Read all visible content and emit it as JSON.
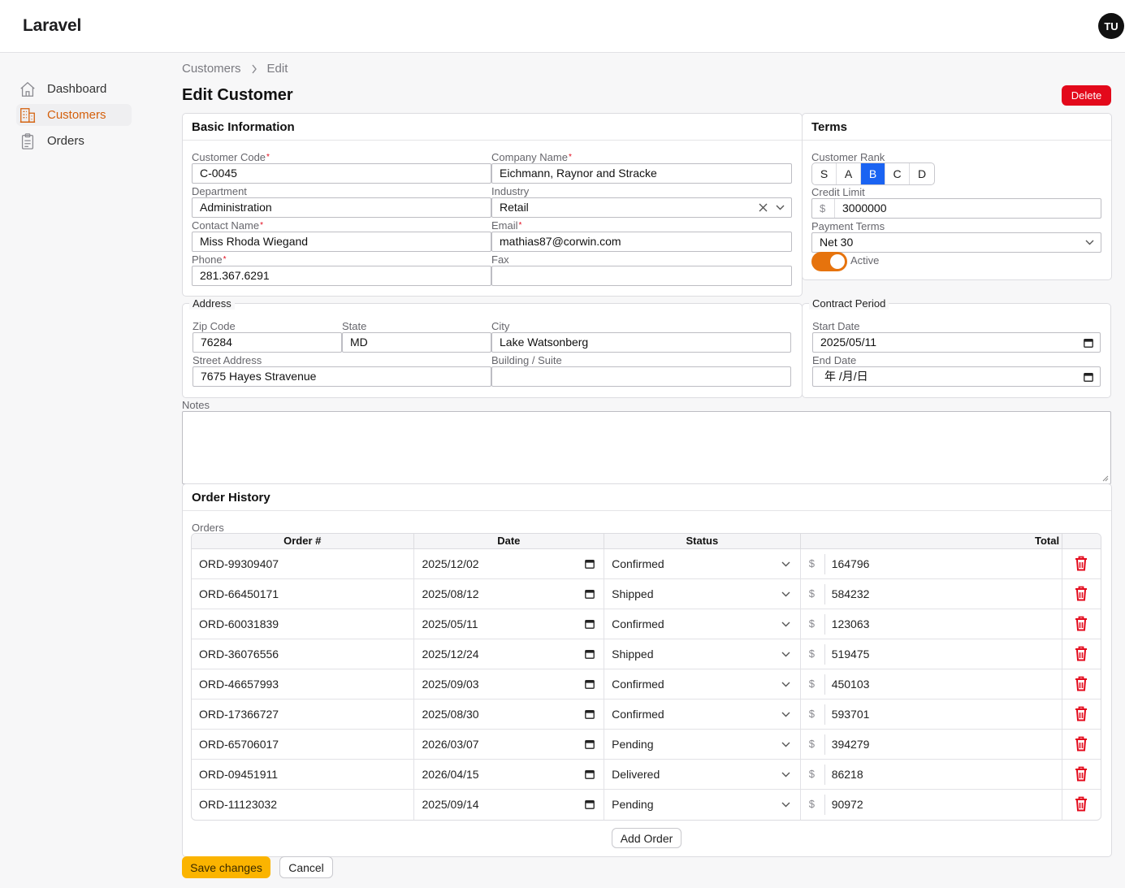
{
  "app": {
    "brand": "Laravel",
    "user_initials": "TU"
  },
  "sidebar": {
    "items": [
      {
        "label": "Dashboard",
        "icon": "home-icon"
      },
      {
        "label": "Customers",
        "icon": "building-icon",
        "active": true
      },
      {
        "label": "Orders",
        "icon": "clipboard-icon"
      }
    ]
  },
  "breadcrumb": {
    "parent": "Customers",
    "current": "Edit"
  },
  "page": {
    "title": "Edit Customer",
    "delete_label": "Delete"
  },
  "basic": {
    "heading": "Basic Information",
    "customer_code_label": "Customer Code",
    "customer_code": "C-0045",
    "company_name_label": "Company Name",
    "company_name": "Eichmann, Raynor and Stracke",
    "department_label": "Department",
    "department": "Administration",
    "industry_label": "Industry",
    "industry": "Retail",
    "contact_name_label": "Contact Name",
    "contact_name": "Miss Rhoda Wiegand",
    "email_label": "Email",
    "email": "mathias87@corwin.com",
    "phone_label": "Phone",
    "phone": "281.367.6291",
    "fax_label": "Fax",
    "fax": ""
  },
  "terms": {
    "heading": "Terms",
    "rank_label": "Customer Rank",
    "ranks": [
      "S",
      "A",
      "B",
      "C",
      "D"
    ],
    "selected_rank": "B",
    "credit_limit_label": "Credit Limit",
    "currency": "$",
    "credit_limit": "3000000",
    "payment_terms_label": "Payment Terms",
    "payment_terms": "Net 30",
    "active_label": "Active",
    "active": true
  },
  "address": {
    "legend": "Address",
    "zip_label": "Zip Code",
    "zip": "76284",
    "state_label": "State",
    "state": "MD",
    "city_label": "City",
    "city": "Lake Watsonberg",
    "street_label": "Street Address",
    "street": "7675 Hayes Stravenue",
    "building_label": "Building / Suite",
    "building": ""
  },
  "contract": {
    "legend": "Contract Period",
    "start_label": "Start Date",
    "start": "2025/05/11",
    "end_label": "End Date",
    "end_placeholder": "年 /月/日"
  },
  "notes": {
    "label": "Notes",
    "value": ""
  },
  "order_history": {
    "heading": "Order History",
    "orders_label": "Orders",
    "columns": [
      "Order #",
      "Date",
      "Status",
      "Total"
    ],
    "rows": [
      {
        "order_no": "ORD-99309407",
        "date": "2025/12/02",
        "status": "Confirmed",
        "total": "164796"
      },
      {
        "order_no": "ORD-66450171",
        "date": "2025/08/12",
        "status": "Shipped",
        "total": "584232"
      },
      {
        "order_no": "ORD-60031839",
        "date": "2025/05/11",
        "status": "Confirmed",
        "total": "123063"
      },
      {
        "order_no": "ORD-36076556",
        "date": "2025/12/24",
        "status": "Shipped",
        "total": "519475"
      },
      {
        "order_no": "ORD-46657993",
        "date": "2025/09/03",
        "status": "Confirmed",
        "total": "450103"
      },
      {
        "order_no": "ORD-17366727",
        "date": "2025/08/30",
        "status": "Confirmed",
        "total": "593701"
      },
      {
        "order_no": "ORD-65706017",
        "date": "2026/03/07",
        "status": "Pending",
        "total": "394279"
      },
      {
        "order_no": "ORD-09451911",
        "date": "2026/04/15",
        "status": "Delivered",
        "total": "86218"
      },
      {
        "order_no": "ORD-11123032",
        "date": "2025/09/14",
        "status": "Pending",
        "total": "90972"
      }
    ],
    "add_label": "Add Order"
  },
  "actions": {
    "save_label": "Save changes",
    "cancel_label": "Cancel"
  },
  "colors": {
    "accent": "#d4600c",
    "primary": "#1a63f2",
    "danger": "#e3091b",
    "save": "#fbb400",
    "toggle": "#e6730d"
  }
}
